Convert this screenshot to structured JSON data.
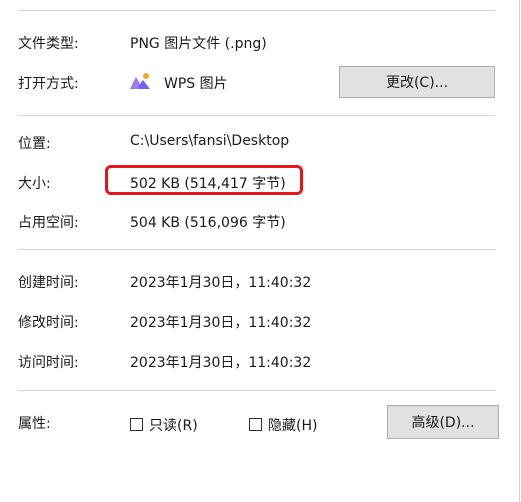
{
  "file_type": {
    "label": "文件类型:",
    "value": "PNG 图片文件 (.png)"
  },
  "open_with": {
    "label": "打开方式:",
    "app_name": "WPS 图片",
    "app_icon": "wps-picture-icon",
    "change_button": "更改(C)..."
  },
  "location": {
    "label": "位置:",
    "value": "C:\\Users\\fansi\\Desktop"
  },
  "size": {
    "label": "大小:",
    "value": "502 KB (514,417 字节)"
  },
  "size_on_disk": {
    "label": "占用空间:",
    "value": "504 KB (516,096 字节)"
  },
  "created": {
    "label": "创建时间:",
    "value": "2023年1月30日，11:40:32"
  },
  "modified": {
    "label": "修改时间:",
    "value": "2023年1月30日，11:40:32"
  },
  "accessed": {
    "label": "访问时间:",
    "value": "2023年1月30日，11:40:32"
  },
  "attributes": {
    "label": "属性:",
    "readonly": {
      "label": "只读(R)",
      "checked": false
    },
    "hidden": {
      "label": "隐藏(H)",
      "checked": false
    },
    "advanced_button": "高级(D)..."
  },
  "colors": {
    "highlight": "#e8141b",
    "divider": "#d8d8d8",
    "button_bg": "#e1e1e1"
  }
}
